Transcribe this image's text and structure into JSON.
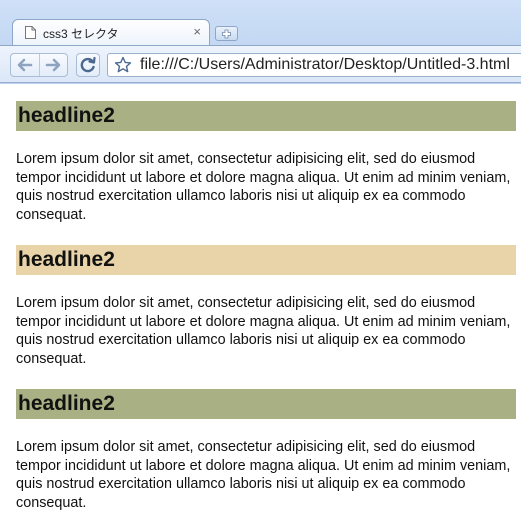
{
  "browser": {
    "tab_title": "css3 セレクタ",
    "tab_close": "×",
    "url": "file:///C:/Users/Administrator/Desktop/Untitled-3.html"
  },
  "sections": [
    {
      "headline": "headline2",
      "headline_color": "#a9b083",
      "text": "Lorem ipsum dolor sit amet, consectetur adipisicing elit, sed do eiusmod tempor incididunt ut labore et dolore magna aliqua. Ut enim ad minim veniam, quis nostrud exercitation ullamco laboris nisi ut aliquip ex ea commodo consequat."
    },
    {
      "headline": "headline2",
      "headline_color": "#e8d4a8",
      "text": "Lorem ipsum dolor sit amet, consectetur adipisicing elit, sed do eiusmod tempor incididunt ut labore et dolore magna aliqua. Ut enim ad minim veniam, quis nostrud exercitation ullamco laboris nisi ut aliquip ex ea commodo consequat."
    },
    {
      "headline": "headline2",
      "headline_color": "#a9b083",
      "text": "Lorem ipsum dolor sit amet, consectetur adipisicing elit, sed do eiusmod tempor incididunt ut labore et dolore magna aliqua. Ut enim ad minim veniam, quis nostrud exercitation ullamco laboris nisi ut aliquip ex ea commodo consequat."
    }
  ],
  "icons": {
    "tab": "page-icon",
    "new_tab": "new-tab-icon",
    "back": "back-arrow-icon",
    "forward": "forward-arrow-icon",
    "reload": "reload-icon",
    "bookmark": "star-icon"
  }
}
